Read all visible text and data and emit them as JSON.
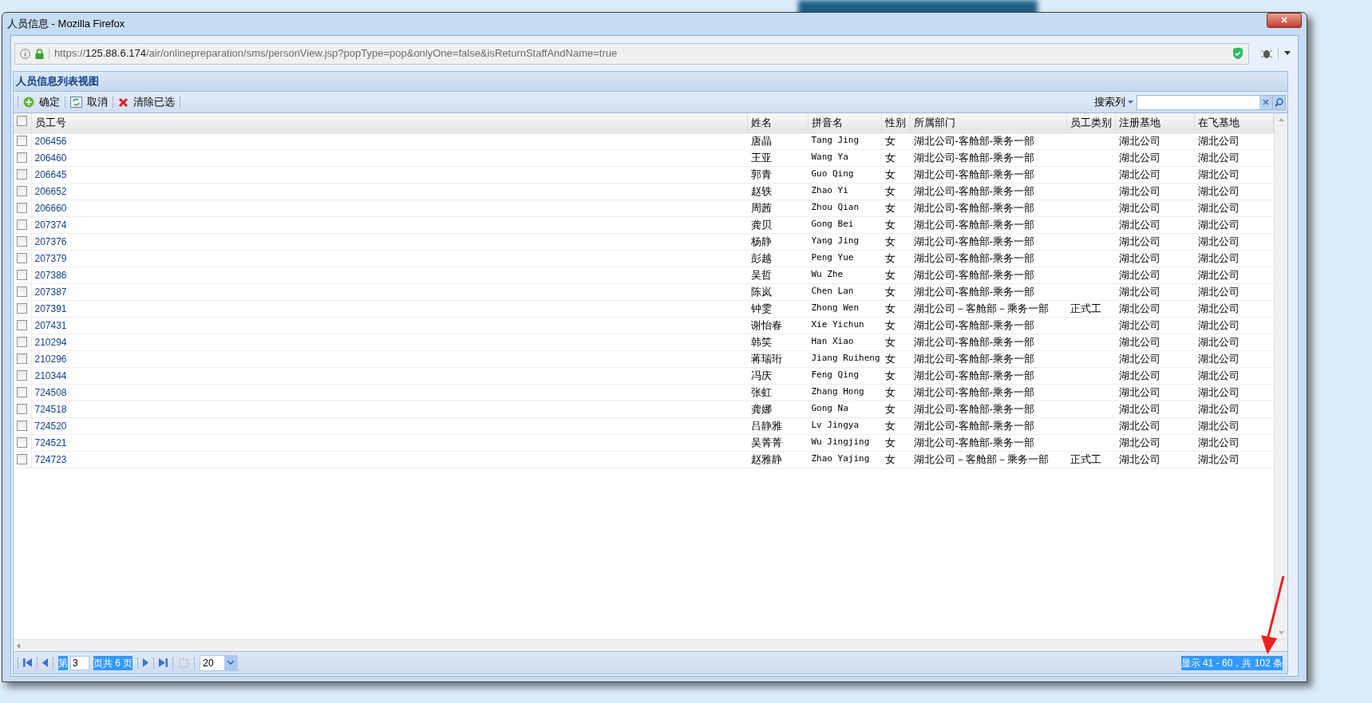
{
  "window": {
    "title": "人员信息 - Mozilla Firefox",
    "close": "×"
  },
  "address_bar": {
    "scheme": "https://",
    "host": "125.88.6.174",
    "path": "/air/onlinepreparation/sms/personView.jsp?popType=pop&onlyOne=false&isReturnStaffAndName=true"
  },
  "panel": {
    "title": "人员信息列表视图"
  },
  "toolbar": {
    "buttons": [
      {
        "kind": "add",
        "label": "确定"
      },
      {
        "kind": "refresh",
        "label": "取消"
      },
      {
        "kind": "delete",
        "label": "清除已选"
      }
    ],
    "search_column": "搜索列"
  },
  "table": {
    "select_all": {
      "checked": false
    },
    "columns": [
      "员工号",
      "姓名",
      "拼音名",
      "性别",
      "所属部门",
      "员工类别",
      "注册基地",
      "在飞基地"
    ],
    "rows": [
      {
        "checked": false,
        "cells": [
          "206456",
          "唐晶",
          "Tang Jing",
          "女",
          "湖北公司-客舱部-乘务一部",
          "",
          "湖北公司",
          "湖北公司"
        ]
      },
      {
        "checked": false,
        "cells": [
          "206460",
          "王亚",
          "Wang Ya",
          "女",
          "湖北公司-客舱部-乘务一部",
          "",
          "湖北公司",
          "湖北公司"
        ]
      },
      {
        "checked": false,
        "cells": [
          "206645",
          "郭青",
          "Guo Qing",
          "女",
          "湖北公司-客舱部-乘务一部",
          "",
          "湖北公司",
          "湖北公司"
        ]
      },
      {
        "checked": false,
        "cells": [
          "206652",
          "赵轶",
          "Zhao Yi",
          "女",
          "湖北公司-客舱部-乘务一部",
          "",
          "湖北公司",
          "湖北公司"
        ]
      },
      {
        "checked": false,
        "cells": [
          "206660",
          "周茜",
          "Zhou Qian",
          "女",
          "湖北公司-客舱部-乘务一部",
          "",
          "湖北公司",
          "湖北公司"
        ]
      },
      {
        "checked": false,
        "cells": [
          "207374",
          "龚贝",
          "Gong Bei",
          "女",
          "湖北公司-客舱部-乘务一部",
          "",
          "湖北公司",
          "湖北公司"
        ]
      },
      {
        "checked": false,
        "cells": [
          "207376",
          "杨静",
          "Yang Jing",
          "女",
          "湖北公司-客舱部-乘务一部",
          "",
          "湖北公司",
          "湖北公司"
        ]
      },
      {
        "checked": false,
        "cells": [
          "207379",
          "彭越",
          "Peng Yue",
          "女",
          "湖北公司-客舱部-乘务一部",
          "",
          "湖北公司",
          "湖北公司"
        ]
      },
      {
        "checked": false,
        "cells": [
          "207386",
          "吴哲",
          "Wu Zhe",
          "女",
          "湖北公司-客舱部-乘务一部",
          "",
          "湖北公司",
          "湖北公司"
        ]
      },
      {
        "checked": false,
        "cells": [
          "207387",
          "陈岚",
          "Chen Lan",
          "女",
          "湖北公司-客舱部-乘务一部",
          "",
          "湖北公司",
          "湖北公司"
        ]
      },
      {
        "checked": false,
        "cells": [
          "207391",
          "钟雯",
          "Zhong Wen",
          "女",
          "湖北公司－客舱部－乘务一部",
          "正式工",
          "湖北公司",
          "湖北公司"
        ]
      },
      {
        "checked": false,
        "cells": [
          "207431",
          "谢怡春",
          "Xie Yichun",
          "女",
          "湖北公司-客舱部-乘务一部",
          "",
          "湖北公司",
          "湖北公司"
        ]
      },
      {
        "checked": false,
        "cells": [
          "210294",
          "韩笑",
          "Han Xiao",
          "女",
          "湖北公司-客舱部-乘务一部",
          "",
          "湖北公司",
          "湖北公司"
        ]
      },
      {
        "checked": false,
        "cells": [
          "210296",
          "蒋瑞珩",
          "Jiang Ruiheng",
          "女",
          "湖北公司-客舱部-乘务一部",
          "",
          "湖北公司",
          "湖北公司"
        ]
      },
      {
        "checked": false,
        "cells": [
          "210344",
          "冯庆",
          "Feng Qing",
          "女",
          "湖北公司-客舱部-乘务一部",
          "",
          "湖北公司",
          "湖北公司"
        ]
      },
      {
        "checked": false,
        "cells": [
          "724508",
          "张虹",
          "Zhang Hong",
          "女",
          "湖北公司-客舱部-乘务一部",
          "",
          "湖北公司",
          "湖北公司"
        ]
      },
      {
        "checked": false,
        "cells": [
          "724518",
          "龚娜",
          "Gong Na",
          "女",
          "湖北公司-客舱部-乘务一部",
          "",
          "湖北公司",
          "湖北公司"
        ]
      },
      {
        "checked": false,
        "cells": [
          "724520",
          "吕静雅",
          "Lv Jingya",
          "女",
          "湖北公司-客舱部-乘务一部",
          "",
          "湖北公司",
          "湖北公司"
        ]
      },
      {
        "checked": false,
        "cells": [
          "724521",
          "吴菁菁",
          "Wu Jingjing",
          "女",
          "湖北公司-客舱部-乘务一部",
          "",
          "湖北公司",
          "湖北公司"
        ]
      },
      {
        "checked": false,
        "cells": [
          "724723",
          "赵雅静",
          "Zhao Yajing",
          "女",
          "湖北公司－客舱部－乘务一部",
          "正式工",
          "湖北公司",
          "湖北公司"
        ]
      }
    ]
  },
  "pager": {
    "page_prefix": "第",
    "page": "3",
    "page_suffix": "页共 6 页",
    "page_size": "20",
    "summary": "显示 41 - 60，共 102 条"
  }
}
